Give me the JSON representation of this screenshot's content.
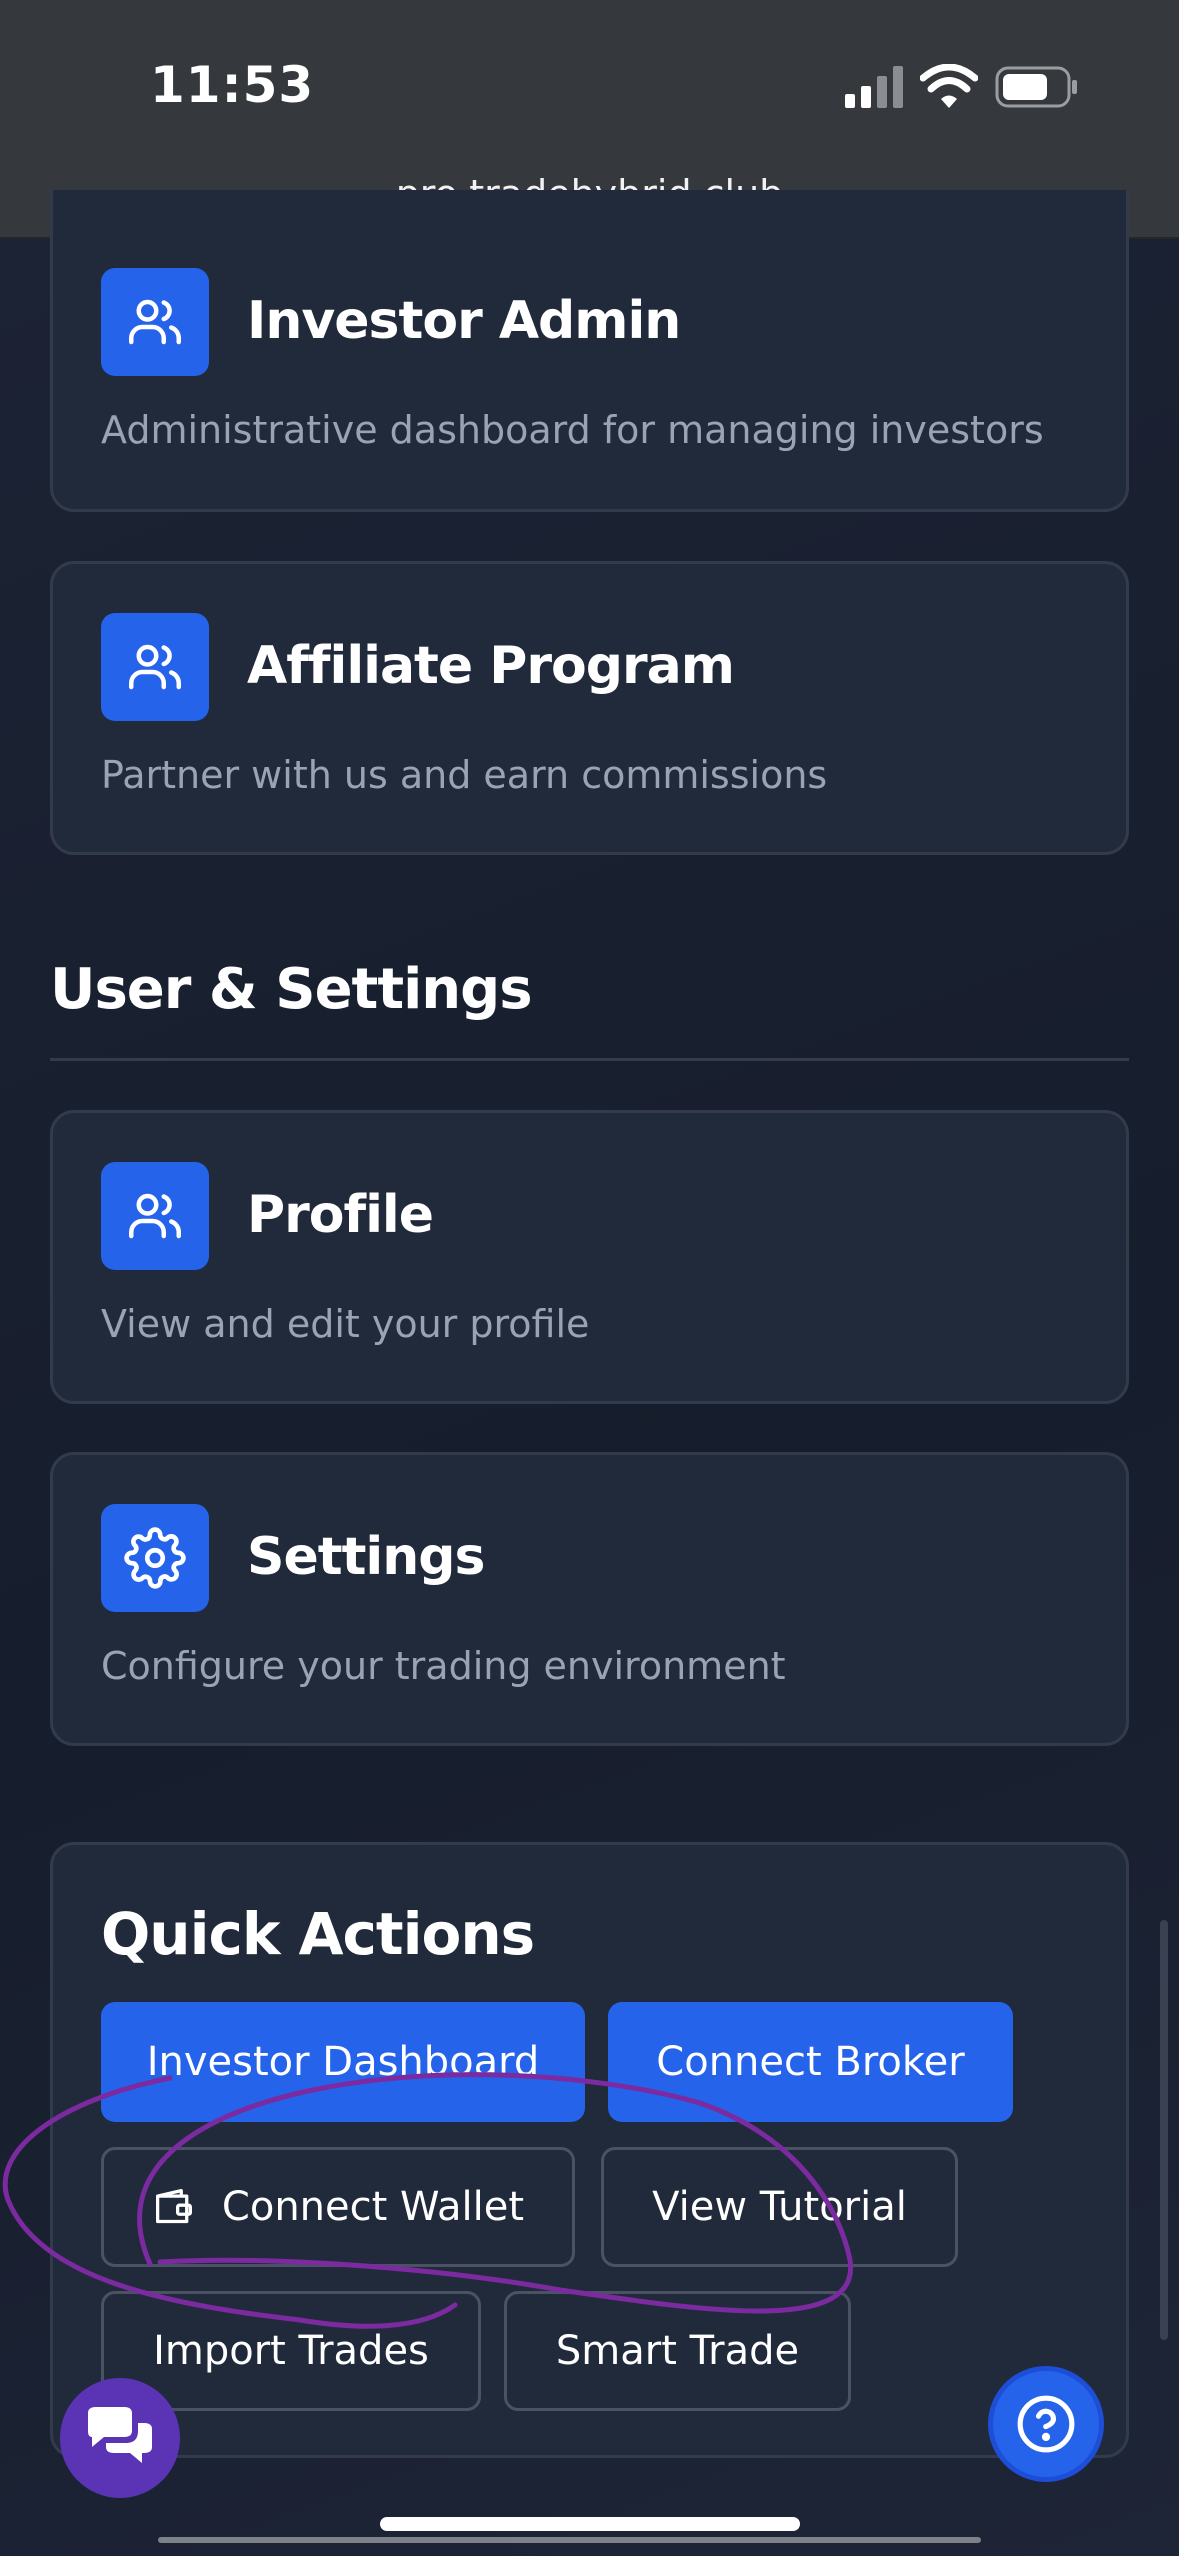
{
  "status_bar": {
    "time": "11:53",
    "url": "pro.tradehybrid.club",
    "icons": [
      "cellular-signal-icon",
      "wifi-icon",
      "battery-icon"
    ]
  },
  "cards_top": [
    {
      "title": "Investor Admin",
      "description": "Administrative dashboard for managing investors",
      "icon": "users-icon"
    },
    {
      "title": "Affiliate Program",
      "description": "Partner with us and earn commissions",
      "icon": "users-icon"
    }
  ],
  "user_settings": {
    "heading": "User & Settings",
    "cards": [
      {
        "title": "Profile",
        "description": "View and edit your profile",
        "icon": "users-icon"
      },
      {
        "title": "Settings",
        "description": "Configure your trading environment",
        "icon": "gear-icon"
      }
    ]
  },
  "quick_actions": {
    "title": "Quick Actions",
    "buttons": [
      {
        "label": "Investor Dashboard",
        "style": "primary"
      },
      {
        "label": "Connect Broker",
        "style": "primary"
      },
      {
        "label": "Connect Wallet",
        "style": "outline",
        "icon": "wallet-icon"
      },
      {
        "label": "View Tutorial",
        "style": "outline"
      },
      {
        "label": "Import Trades",
        "style": "outline"
      },
      {
        "label": "Smart Trade",
        "style": "outline"
      }
    ]
  },
  "floating": {
    "chat_icon": "chat-bubbles-icon",
    "help_icon": "question-mark-icon"
  },
  "colors": {
    "background": "#1b2233",
    "card": "#212a3b",
    "accent": "#2563eb",
    "annotation": "#7b2aa0",
    "chat": "#5b34b5",
    "muted_text": "#9aa3b2"
  }
}
